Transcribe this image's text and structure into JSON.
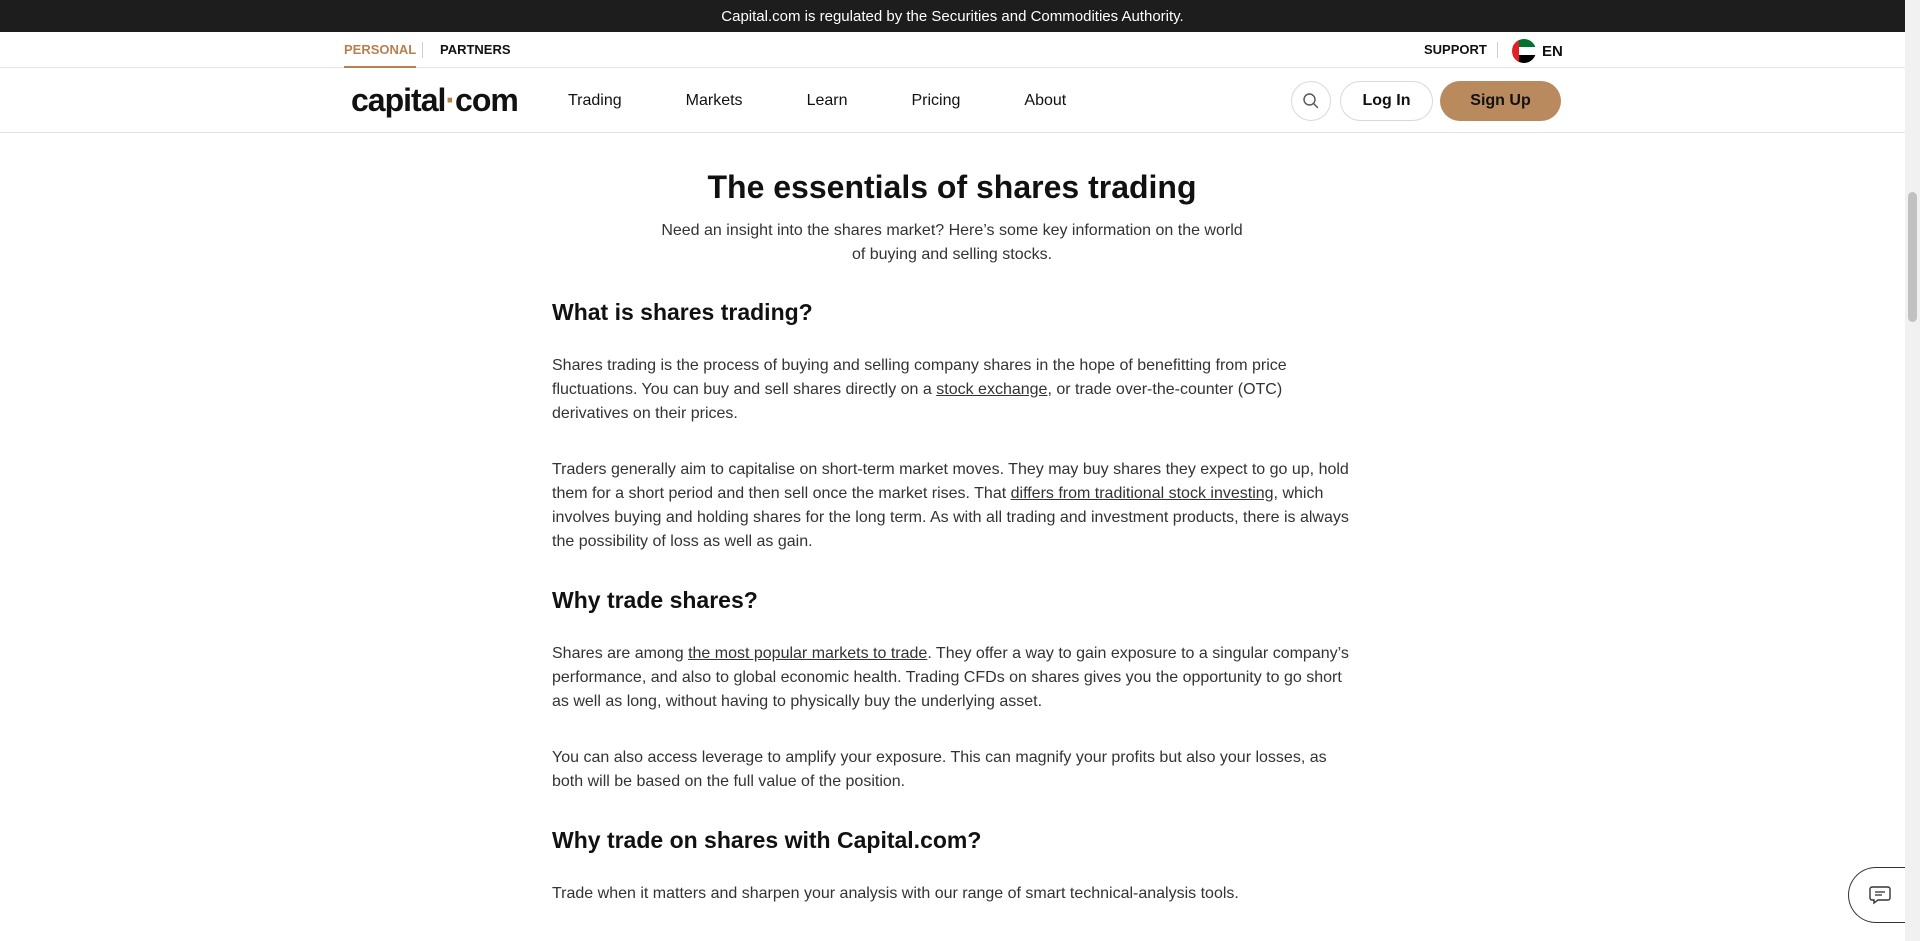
{
  "reg_bar": {
    "text": "Capital.com is regulated by the Securities and Commodities Authority."
  },
  "topnav": {
    "personal": "PERSONAL",
    "partners": "PARTNERS",
    "support": "SUPPORT",
    "language": "EN",
    "flag_icon": "uae-flag-icon"
  },
  "header": {
    "logo_left": "capital",
    "logo_dot": "·",
    "logo_right": "com",
    "menu": [
      "Trading",
      "Markets",
      "Learn",
      "Pricing",
      "About"
    ],
    "search_icon": "search-icon",
    "login": "Log In",
    "signup": "Sign Up"
  },
  "colors": {
    "accent": "#b9804f",
    "signup_bg": "#b98a5e",
    "reg_bar_bg": "#1d1d1d"
  },
  "article": {
    "title": "The essentials of shares trading",
    "subtitle_line1": "Need an insight into the shares market? Here’s some key information on the world",
    "subtitle_line2": "of buying and selling stocks.",
    "section1": {
      "heading": "What is shares trading?",
      "p1_a": "Shares trading is the process of buying and selling company shares in the hope of benefitting from price fluctuations. You can buy and sell shares directly on a ",
      "p1_link": "stock exchange",
      "p1_b": ", or trade over-the-counter (OTC) derivatives on their prices.",
      "p2_a": "Traders generally aim to capitalise on short-term market moves. They may buy shares they expect to go up, hold them for a short period and then sell once the market rises. That ",
      "p2_link": "differs from traditional stock investing",
      "p2_b": ", which involves buying and holding shares for the long term. As with all trading and investment products, there is always the possibility of loss as well as gain."
    },
    "section2": {
      "heading": "Why trade shares?",
      "p1_a": "Shares are among ",
      "p1_link": "the most popular markets to trade",
      "p1_b": ". They offer a way to gain exposure to a singular company’s performance, and also to global economic health. Trading CFDs on shares gives you the opportunity to go short as well as long, without having to physically buy the underlying asset.",
      "p2": "You can also access leverage to amplify your exposure. This can magnify your profits but also your losses, as both will be based on the full value of the position."
    },
    "section3": {
      "heading": "Why trade on shares with Capital.com?",
      "p1": "Trade when it matters and sharpen your analysis with our range of smart technical-analysis tools."
    }
  },
  "chat": {
    "icon": "chat-icon"
  }
}
